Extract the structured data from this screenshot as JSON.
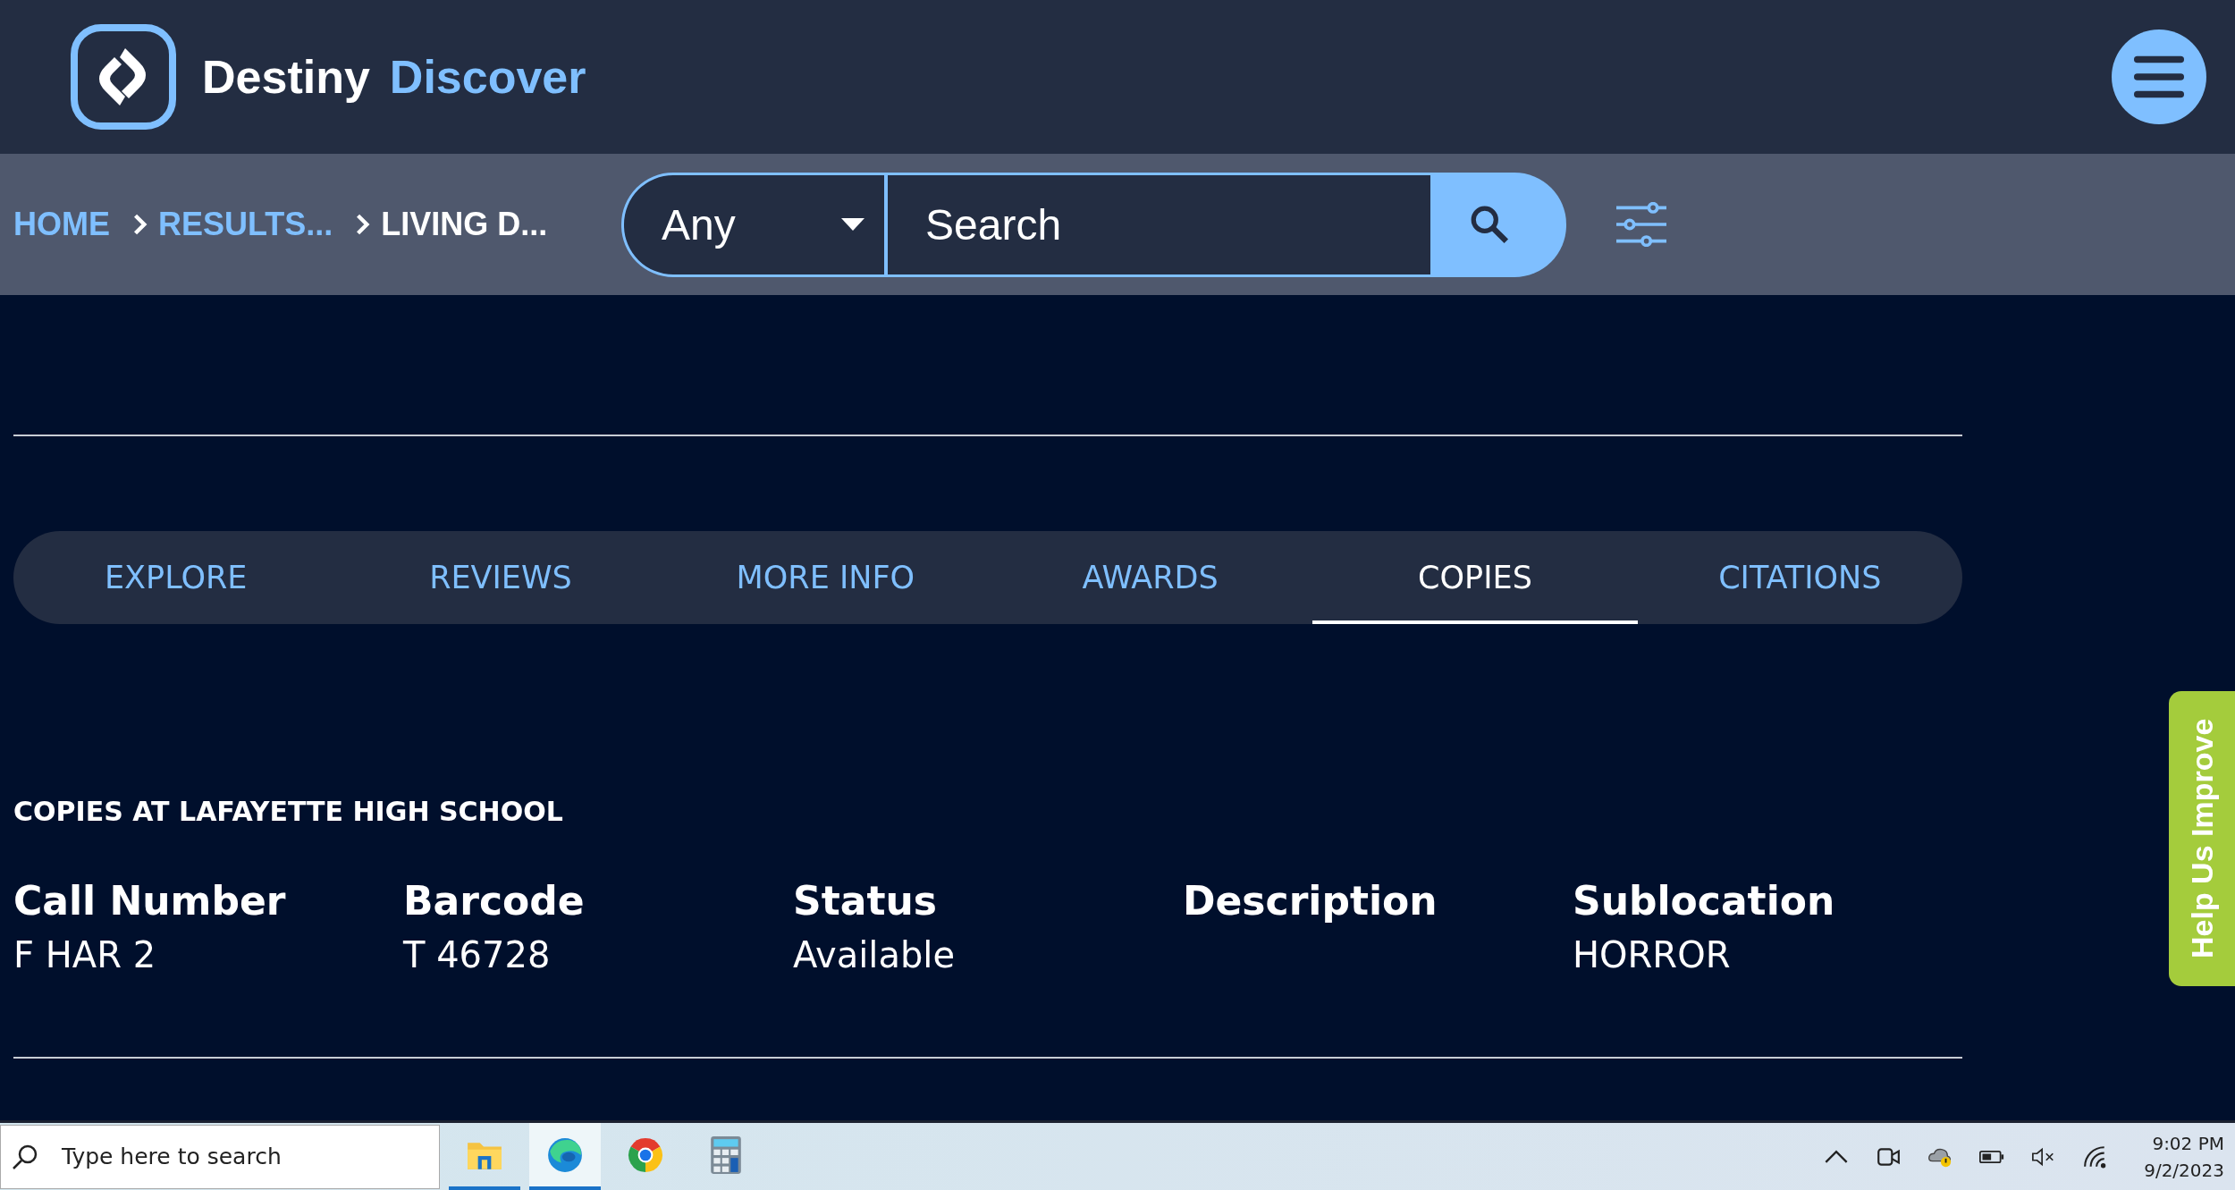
{
  "header": {
    "brand": "Destiny",
    "product": "Discover"
  },
  "breadcrumbs": [
    {
      "label": "HOME",
      "current": false
    },
    {
      "label": "RESULTS...",
      "current": false
    },
    {
      "label": "LIVING D...",
      "current": true
    }
  ],
  "search": {
    "scope": "Any",
    "placeholder": "Search"
  },
  "tabs": [
    {
      "label": "EXPLORE",
      "selected": false
    },
    {
      "label": "REVIEWS",
      "selected": false
    },
    {
      "label": "MORE INFO",
      "selected": false
    },
    {
      "label": "AWARDS",
      "selected": false
    },
    {
      "label": "COPIES",
      "selected": true
    },
    {
      "label": "CITATIONS",
      "selected": false
    }
  ],
  "copies": {
    "heading": "COPIES AT LAFAYETTE HIGH SCHOOL",
    "columns": [
      {
        "header": "Call Number",
        "value": "F HAR 2"
      },
      {
        "header": "Barcode",
        "value": "T 46728"
      },
      {
        "header": "Status",
        "value": "Available"
      },
      {
        "header": "Description"
      },
      {
        "header": "Sublocation",
        "value": "HORROR"
      }
    ]
  },
  "help_tab": "Help Us Improve",
  "taskbar": {
    "search_placeholder": "Type here to search",
    "apps": [
      {
        "kind": "explorer",
        "running": true,
        "selected": false
      },
      {
        "kind": "edge",
        "running": true,
        "selected": true
      },
      {
        "kind": "chrome",
        "running": false,
        "selected": false
      },
      {
        "kind": "calculator",
        "running": false,
        "selected": false
      }
    ],
    "time": "9:02 PM",
    "date": "9/2/2023"
  }
}
